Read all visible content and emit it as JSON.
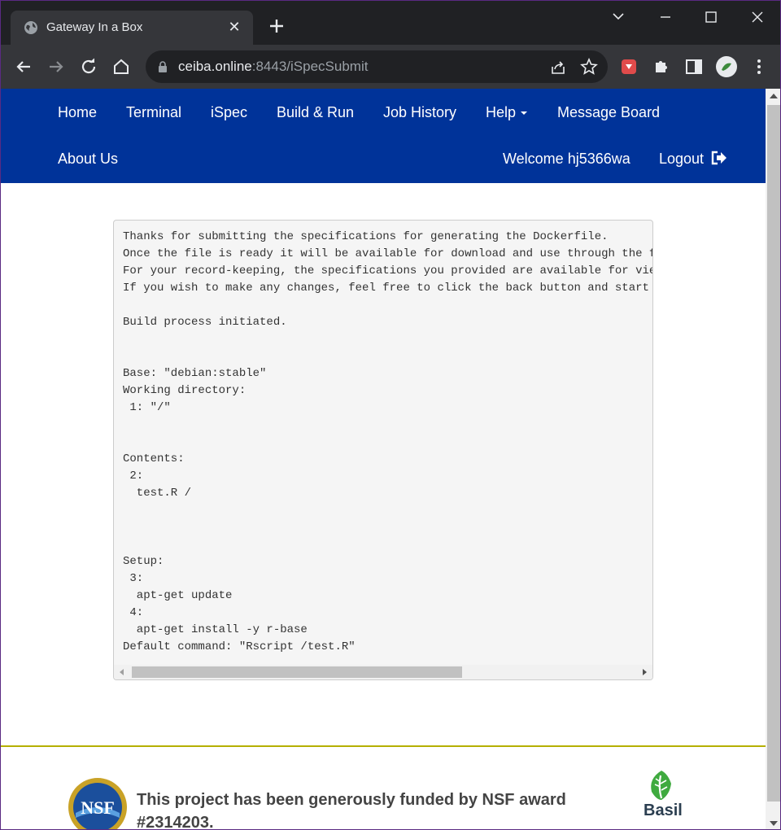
{
  "browser": {
    "tab_title": "Gateway In a Box",
    "url_host": "ceiba.online",
    "url_rest": ":8443/iSpecSubmit"
  },
  "nav": {
    "items": [
      "Home",
      "Terminal",
      "iSpec",
      "Build & Run",
      "Job History",
      "Help",
      "Message Board",
      "About Us"
    ],
    "welcome": "Welcome hj5366wa",
    "logout": "Logout"
  },
  "output": {
    "lines": [
      "Thanks for submitting the specifications for generating the Dockerfile.",
      "Once the file is ready it will be available for download and use through the foll",
      "For your record-keeping, the specifications you provided are available for viewin",
      "If you wish to make any changes, feel free to click the back button and start ane",
      "",
      "Build process initiated.",
      "",
      "",
      "Base: \"debian:stable\"",
      "Working directory:",
      " 1: \"/\"",
      "",
      "",
      "Contents:",
      " 2:",
      "  test.R /",
      "",
      "",
      "",
      "Setup:",
      " 3:",
      "  apt-get update",
      " 4:",
      "  apt-get install -y r-base",
      "Default command: \"Rscript /test.R\""
    ]
  },
  "footer": {
    "funding": "This project has been generously funded by NSF award #2314203.",
    "nsf_logo_text": "NSF",
    "basil": "Basil"
  },
  "colors": {
    "navbar": "#003399",
    "footer_rule": "#b5b000"
  }
}
